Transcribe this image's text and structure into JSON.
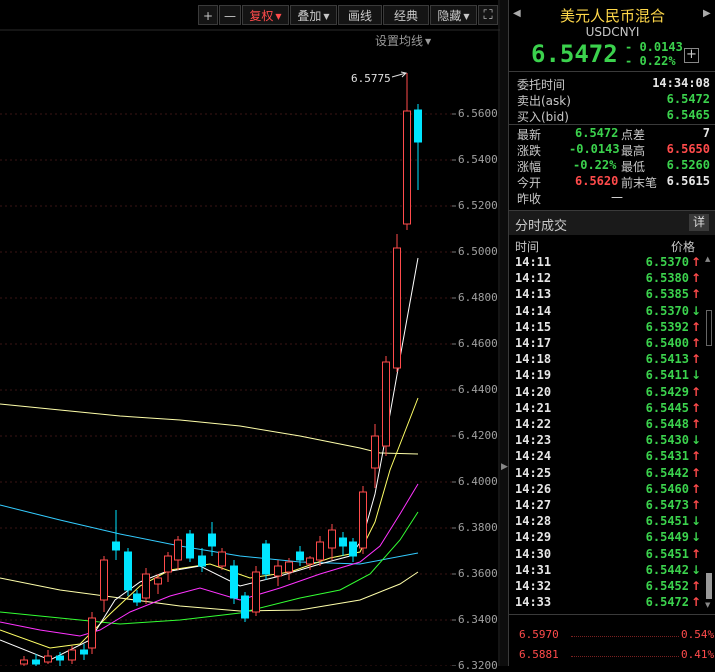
{
  "toolbar": {
    "zoom_in": "+",
    "zoom_out": "—",
    "adjust": "复权",
    "overlay": "叠加",
    "draw": "画线",
    "classic": "经典",
    "hide": "隐藏",
    "fullscreen_icon": "fullscreen-icon"
  },
  "chart": {
    "ma_setting": "设置均线",
    "peak_label": "6.5775",
    "y_ticks": [
      "6.5600",
      "6.5400",
      "6.5200",
      "6.5000",
      "6.4800",
      "6.4600",
      "6.4400",
      "6.4200",
      "6.4000",
      "6.3800",
      "6.3600",
      "6.3400",
      "6.3200"
    ],
    "colors": {
      "up": "#ff4b4b",
      "down": "#00e5ff",
      "ma5": "#ffffff",
      "ma10": "#ffff66",
      "ma20": "#ff33ff",
      "ma30": "#33ff33",
      "ma60": "#ffffaa",
      "ma120": "#33ccff"
    }
  },
  "quote": {
    "name": "美元人民币混合",
    "code": "USDCNYI",
    "price": "6.5472",
    "change": "- 0.0143",
    "change_pct": "- 0.22%",
    "add_icon": "+"
  },
  "info": {
    "entrust_time_label": "委托时间",
    "entrust_time": "14:34:08",
    "ask_label": "卖出(ask)",
    "ask": "6.5472",
    "bid_label": "买入(bid)",
    "bid": "6.5465",
    "latest_label": "最新",
    "latest": "6.5472",
    "spread_label": "点差",
    "spread": "7",
    "change_label": "涨跌",
    "change": "-0.0143",
    "high_label": "最高",
    "high": "6.5650",
    "pct_label": "涨幅",
    "pct": "-0.22%",
    "low_label": "最低",
    "low": "6.5260",
    "open_label": "今开",
    "open": "6.5620",
    "prev_label": "前末笔",
    "prev": "6.5615",
    "close_label": "昨收",
    "close": "—"
  },
  "ticks": {
    "title": "分时成交",
    "detail": "详",
    "col_time": "时间",
    "col_price": "价格",
    "rows": [
      {
        "time": "14:11",
        "price": "6.5370",
        "dir": "↑"
      },
      {
        "time": "14:12",
        "price": "6.5380",
        "dir": "↑"
      },
      {
        "time": "14:13",
        "price": "6.5385",
        "dir": "↑"
      },
      {
        "time": "14:14",
        "price": "6.5370",
        "dir": "↓"
      },
      {
        "time": "14:15",
        "price": "6.5392",
        "dir": "↑"
      },
      {
        "time": "14:17",
        "price": "6.5400",
        "dir": "↑"
      },
      {
        "time": "14:18",
        "price": "6.5413",
        "dir": "↑"
      },
      {
        "time": "14:19",
        "price": "6.5411",
        "dir": "↓"
      },
      {
        "time": "14:20",
        "price": "6.5429",
        "dir": "↑"
      },
      {
        "time": "14:21",
        "price": "6.5445",
        "dir": "↑"
      },
      {
        "time": "14:22",
        "price": "6.5448",
        "dir": "↑"
      },
      {
        "time": "14:23",
        "price": "6.5430",
        "dir": "↓"
      },
      {
        "time": "14:24",
        "price": "6.5431",
        "dir": "↑"
      },
      {
        "time": "14:25",
        "price": "6.5442",
        "dir": "↑"
      },
      {
        "time": "14:26",
        "price": "6.5460",
        "dir": "↑"
      },
      {
        "time": "14:27",
        "price": "6.5473",
        "dir": "↑"
      },
      {
        "time": "14:28",
        "price": "6.5451",
        "dir": "↓"
      },
      {
        "time": "14:29",
        "price": "6.5449",
        "dir": "↓"
      },
      {
        "time": "14:30",
        "price": "6.5451",
        "dir": "↑"
      },
      {
        "time": "14:31",
        "price": "6.5442",
        "dir": "↓"
      },
      {
        "time": "14:32",
        "price": "6.5452",
        "dir": "↑"
      },
      {
        "time": "14:33",
        "price": "6.5472",
        "dir": "↑"
      }
    ]
  },
  "mini": {
    "p1": "6.5970",
    "pct1": "0.54%",
    "p2": "6.5881",
    "pct2": "0.41%"
  }
}
